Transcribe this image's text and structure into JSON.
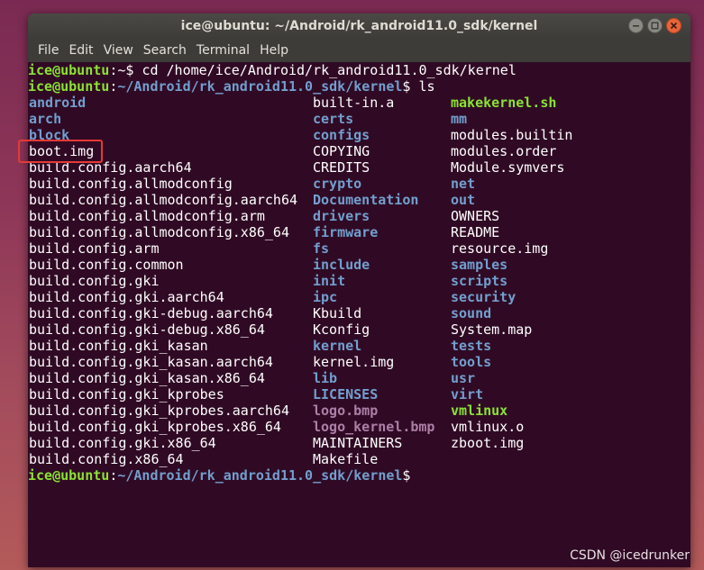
{
  "window": {
    "title": "ice@ubuntu: ~/Android/rk_android11.0_sdk/kernel"
  },
  "menu": [
    "File",
    "Edit",
    "View",
    "Search",
    "Terminal",
    "Help"
  ],
  "prompt": {
    "user": "ice@ubuntu",
    "line1_sep": ":~$ ",
    "line1_cmd": "cd /home/ice/Android/rk_android11.0_sdk/kernel",
    "line2_sep": ":",
    "path": "~/Android/rk_android11.0_sdk/kernel",
    "line2_end": "$ ",
    "line2_cmd": "ls",
    "final_end": "$"
  },
  "listing": {
    "col1": [
      {
        "name": "android",
        "type": "dir"
      },
      {
        "name": "arch",
        "type": "dir"
      },
      {
        "name": "block",
        "type": "dir"
      },
      {
        "name": "boot.img",
        "type": "file"
      },
      {
        "name": "build.config.aarch64",
        "type": "file"
      },
      {
        "name": "build.config.allmodconfig",
        "type": "file"
      },
      {
        "name": "build.config.allmodconfig.aarch64",
        "type": "file"
      },
      {
        "name": "build.config.allmodconfig.arm",
        "type": "file"
      },
      {
        "name": "build.config.allmodconfig.x86_64",
        "type": "file"
      },
      {
        "name": "build.config.arm",
        "type": "file"
      },
      {
        "name": "build.config.common",
        "type": "file"
      },
      {
        "name": "build.config.gki",
        "type": "file"
      },
      {
        "name": "build.config.gki.aarch64",
        "type": "file"
      },
      {
        "name": "build.config.gki-debug.aarch64",
        "type": "file"
      },
      {
        "name": "build.config.gki-debug.x86_64",
        "type": "file"
      },
      {
        "name": "build.config.gki_kasan",
        "type": "file"
      },
      {
        "name": "build.config.gki_kasan.aarch64",
        "type": "file"
      },
      {
        "name": "build.config.gki_kasan.x86_64",
        "type": "file"
      },
      {
        "name": "build.config.gki_kprobes",
        "type": "file"
      },
      {
        "name": "build.config.gki_kprobes.aarch64",
        "type": "file"
      },
      {
        "name": "build.config.gki_kprobes.x86_64",
        "type": "file"
      },
      {
        "name": "build.config.gki.x86_64",
        "type": "file"
      },
      {
        "name": "build.config.x86_64",
        "type": "file"
      }
    ],
    "col2": [
      {
        "name": "built-in.a",
        "type": "file"
      },
      {
        "name": "certs",
        "type": "dir"
      },
      {
        "name": "configs",
        "type": "dir"
      },
      {
        "name": "COPYING",
        "type": "file"
      },
      {
        "name": "CREDITS",
        "type": "file"
      },
      {
        "name": "crypto",
        "type": "dir"
      },
      {
        "name": "Documentation",
        "type": "dir"
      },
      {
        "name": "drivers",
        "type": "dir"
      },
      {
        "name": "firmware",
        "type": "dir"
      },
      {
        "name": "fs",
        "type": "dir"
      },
      {
        "name": "include",
        "type": "dir"
      },
      {
        "name": "init",
        "type": "dir"
      },
      {
        "name": "ipc",
        "type": "dir"
      },
      {
        "name": "Kbuild",
        "type": "file"
      },
      {
        "name": "Kconfig",
        "type": "file"
      },
      {
        "name": "kernel",
        "type": "dir"
      },
      {
        "name": "kernel.img",
        "type": "file"
      },
      {
        "name": "lib",
        "type": "dir"
      },
      {
        "name": "LICENSES",
        "type": "dir"
      },
      {
        "name": "logo.bmp",
        "type": "img"
      },
      {
        "name": "logo_kernel.bmp",
        "type": "img"
      },
      {
        "name": "MAINTAINERS",
        "type": "file"
      },
      {
        "name": "Makefile",
        "type": "file"
      }
    ],
    "col3": [
      {
        "name": "makekernel.sh",
        "type": "exec"
      },
      {
        "name": "mm",
        "type": "dir"
      },
      {
        "name": "modules.builtin",
        "type": "file"
      },
      {
        "name": "modules.order",
        "type": "file"
      },
      {
        "name": "Module.symvers",
        "type": "file"
      },
      {
        "name": "net",
        "type": "dir"
      },
      {
        "name": "out",
        "type": "dir"
      },
      {
        "name": "OWNERS",
        "type": "file"
      },
      {
        "name": "README",
        "type": "file"
      },
      {
        "name": "resource.img",
        "type": "file"
      },
      {
        "name": "samples",
        "type": "dir"
      },
      {
        "name": "scripts",
        "type": "dir"
      },
      {
        "name": "security",
        "type": "dir"
      },
      {
        "name": "sound",
        "type": "dir"
      },
      {
        "name": "System.map",
        "type": "file"
      },
      {
        "name": "tests",
        "type": "dir"
      },
      {
        "name": "tools",
        "type": "dir"
      },
      {
        "name": "usr",
        "type": "dir"
      },
      {
        "name": "virt",
        "type": "dir"
      },
      {
        "name": "vmlinux",
        "type": "exec"
      },
      {
        "name": "vmlinux.o",
        "type": "file"
      },
      {
        "name": "zboot.img",
        "type": "file"
      }
    ]
  },
  "watermark": "CSDN @icedrunker",
  "colors": {
    "terminal_bg": "#300a24",
    "prompt_user": "#8ae234",
    "prompt_path": "#729fcf",
    "dir": "#729fcf",
    "exec": "#8ae234",
    "image": "#ad7fa8",
    "highlight": "#e53935"
  }
}
